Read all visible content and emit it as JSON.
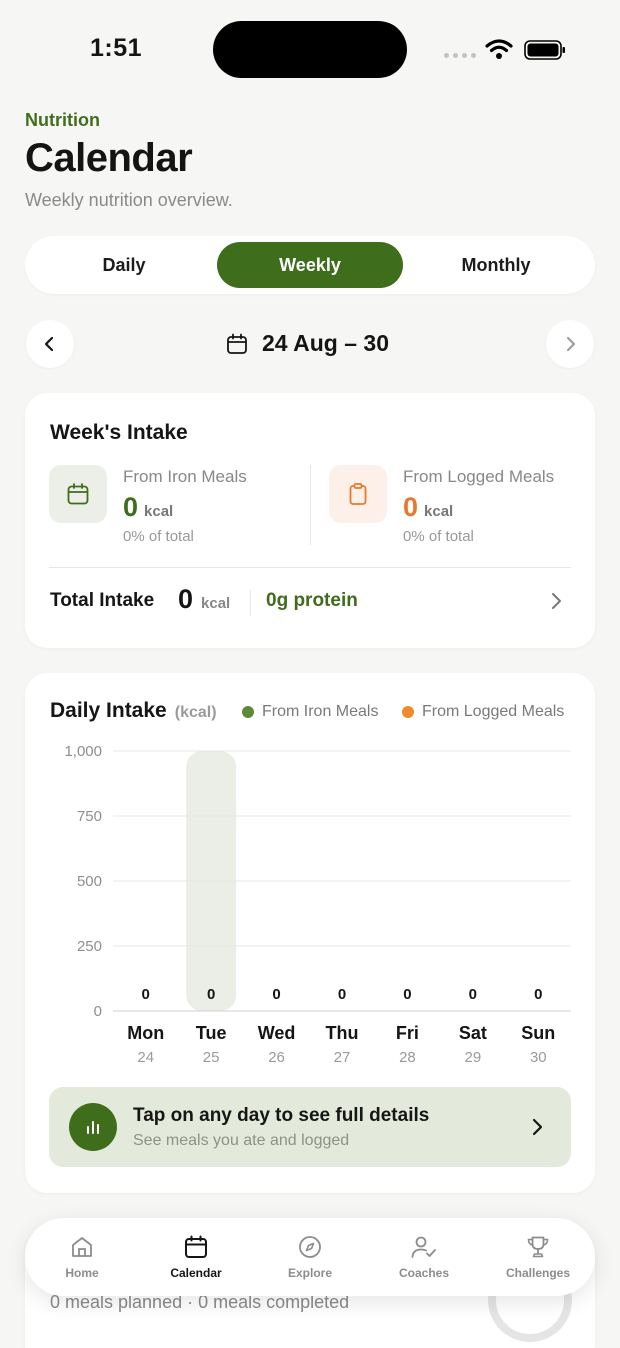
{
  "status_bar": {
    "time": "1:51"
  },
  "header": {
    "eyebrow": "Nutrition",
    "title": "Calendar",
    "subtitle": "Weekly nutrition overview."
  },
  "view_tabs": {
    "items": [
      "Daily",
      "Weekly",
      "Monthly"
    ],
    "selected": "Weekly"
  },
  "week_nav": {
    "range": "24 Aug – 30"
  },
  "weeks_intake": {
    "title": "Week's Intake",
    "iron": {
      "label": "From Iron Meals",
      "value": "0",
      "unit": "kcal",
      "pct": "0% of total"
    },
    "logged": {
      "label": "From Logged Meals",
      "value": "0",
      "unit": "kcal",
      "pct": "0% of total"
    },
    "total": {
      "label": "Total Intake",
      "value": "0",
      "unit": "kcal",
      "protein": "0g protein"
    }
  },
  "daily_intake": {
    "title": "Daily Intake",
    "unit": "(kcal)",
    "legend": {
      "iron": "From Iron Meals",
      "logged": "From Logged Meals"
    },
    "tip": {
      "title": "Tap on any day to see full details",
      "subtitle": "See meals you ate and logged"
    }
  },
  "chart_data": {
    "type": "bar",
    "title": "Daily Intake",
    "ylabel": "(kcal)",
    "ylim": [
      0,
      1000
    ],
    "yticks": [
      "1,000",
      "750",
      "500",
      "250",
      "0"
    ],
    "ytick_values": [
      1000,
      750,
      500,
      250,
      0
    ],
    "categories": [
      "Mon",
      "Tue",
      "Wed",
      "Thu",
      "Fri",
      "Sat",
      "Sun"
    ],
    "dates": [
      "24",
      "25",
      "26",
      "27",
      "28",
      "29",
      "30"
    ],
    "values": [
      0,
      0,
      0,
      0,
      0,
      0,
      0
    ],
    "value_labels": [
      "0",
      "0",
      "0",
      "0",
      "0",
      "0",
      "0"
    ],
    "series": [
      {
        "name": "From Iron Meals",
        "values": [
          0,
          0,
          0,
          0,
          0,
          0,
          0
        ]
      },
      {
        "name": "From Logged Meals",
        "values": [
          0,
          0,
          0,
          0,
          0,
          0,
          0
        ]
      }
    ],
    "highlighted": "Tue",
    "grid": true,
    "legend": "top-right"
  },
  "colors": {
    "accent": "#3e6d1c",
    "orange": "#e9782b",
    "iron_dot": "#5d8a38",
    "logged_dot": "#f08a2e"
  },
  "under_content": {
    "meals_summary": "0 meals planned · 0 meals completed"
  },
  "tabbar": {
    "items": [
      {
        "label": "Home",
        "icon": "home-icon"
      },
      {
        "label": "Calendar",
        "icon": "calendar-icon"
      },
      {
        "label": "Explore",
        "icon": "compass-icon"
      },
      {
        "label": "Coaches",
        "icon": "coach-icon"
      },
      {
        "label": "Challenges",
        "icon": "trophy-icon"
      }
    ],
    "active": "Calendar"
  }
}
